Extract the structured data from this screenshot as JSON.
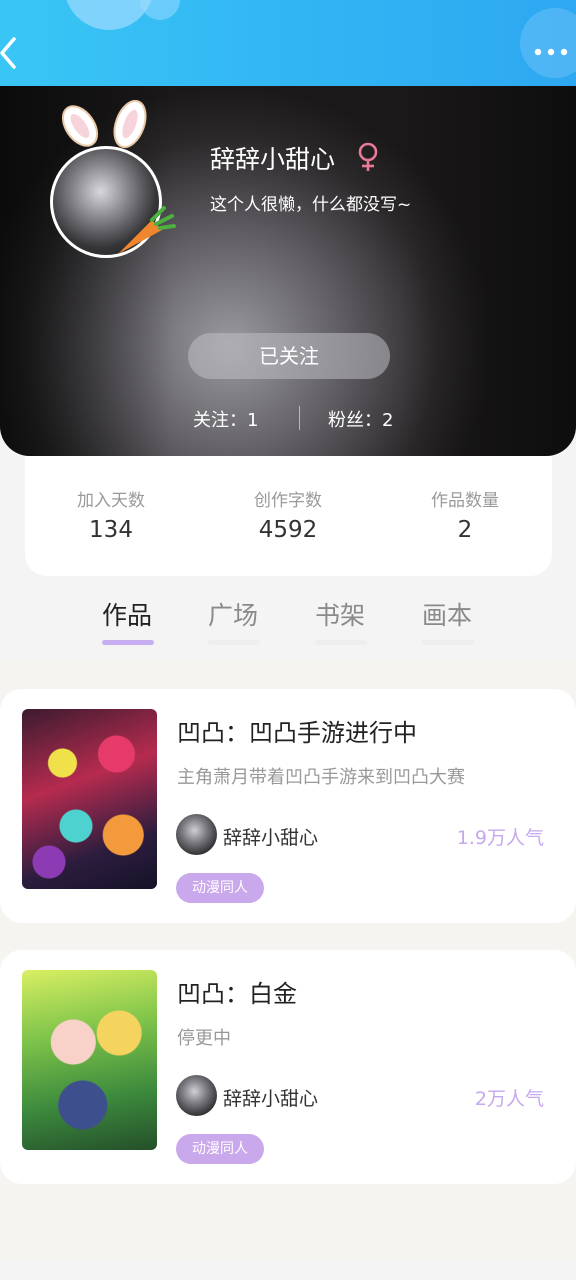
{
  "header": {},
  "profile": {
    "name": "辞辞小甜心",
    "gender_symbol": "♀",
    "bio": "这个人很懒，什么都没写~",
    "follow_button": "已关注",
    "following": "关注：1",
    "followers": "粉丝：2"
  },
  "stats": [
    {
      "label": "加入天数",
      "value": "134"
    },
    {
      "label": "创作字数",
      "value": "4592"
    },
    {
      "label": "作品数量",
      "value": "2"
    }
  ],
  "tabs": [
    {
      "label": "作品",
      "active": true
    },
    {
      "label": "广场",
      "active": false
    },
    {
      "label": "书架",
      "active": false
    },
    {
      "label": "画本",
      "active": false
    }
  ],
  "works": [
    {
      "title": "凹凸：凹凸手游进行中",
      "description": "主角萧月带着凹凸手游来到凹凸大赛",
      "author": "辞辞小甜心",
      "popularity": "1.9万人气",
      "tag": "动漫同人"
    },
    {
      "title": "凹凸：白金",
      "description": "停更中",
      "author": "辞辞小甜心",
      "popularity": "2万人气",
      "tag": "动漫同人"
    }
  ],
  "colors": {
    "topbar": "#31b3f3",
    "accent": "#c7aef0",
    "gender": "#e87a97",
    "popularity": "#c6a8ee"
  }
}
